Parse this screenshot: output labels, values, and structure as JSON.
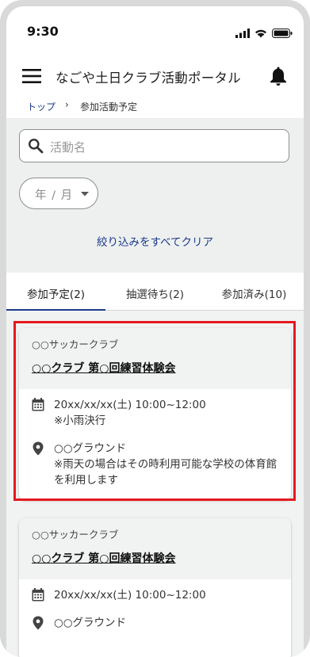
{
  "status_bar": {
    "time": "9:30"
  },
  "app_bar": {
    "title": "なごや土日クラブ活動ポータル"
  },
  "breadcrumb": {
    "home": "トップ",
    "separator": "›",
    "current": "参加活動予定"
  },
  "search": {
    "placeholder": "活動名"
  },
  "filters": {
    "year_month_label": "年 / 月",
    "clear_label": "絞り込みをすべてクリア"
  },
  "tabs": [
    {
      "label": "参加予定(2)"
    },
    {
      "label": "抽選待ち(2)"
    },
    {
      "label": "参加済み(10)"
    }
  ],
  "events": [
    {
      "club": "○○サッカークラブ",
      "title": "○○クラブ 第○回練習体験会",
      "datetime": "20xx/xx/xx(土) 10:00~12:00",
      "date_note": "※小雨決行",
      "location": "○○グラウンド",
      "location_note": "※雨天の場合はその時利用可能な学校の体育館を利用します"
    },
    {
      "club": "○○サッカークラブ",
      "title": "○○クラブ 第○回練習体験会",
      "datetime": "20xx/xx/xx(土) 10:00~12:00",
      "location": "○○グラウンド"
    }
  ],
  "colors": {
    "accent": "#1b3a8a",
    "highlight": "#e5191e",
    "panel": "#eef0f0"
  }
}
